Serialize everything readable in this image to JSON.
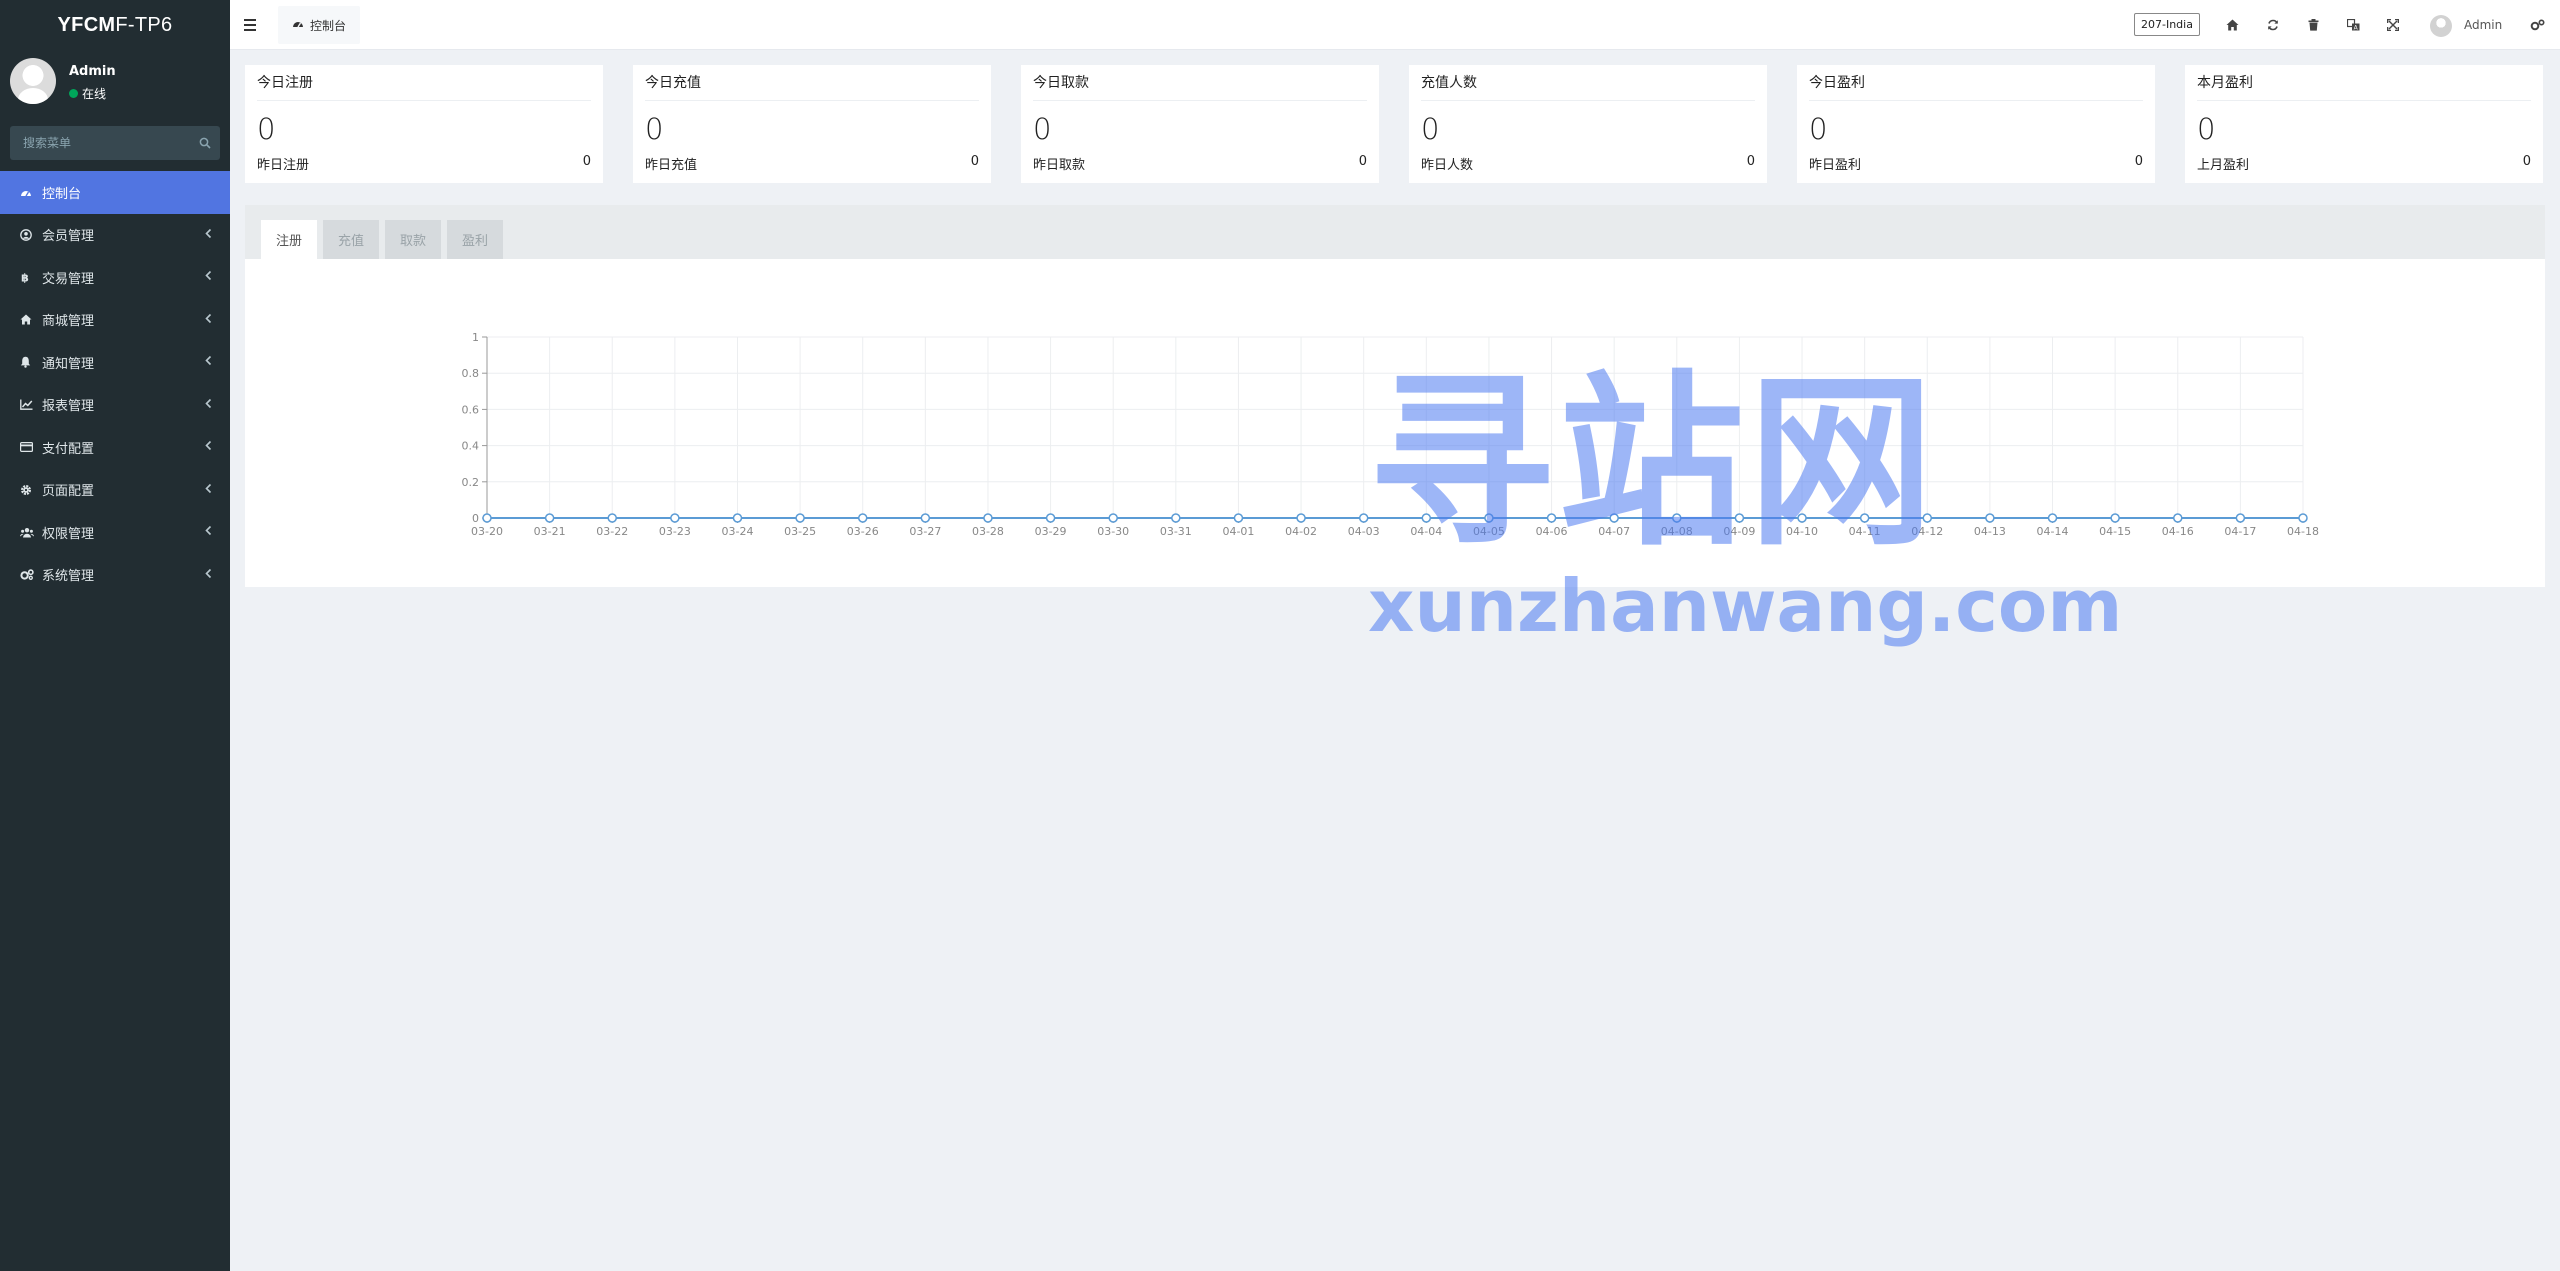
{
  "app": {
    "brand_bold": "YFCM",
    "brand_rest": "F-TP6"
  },
  "user": {
    "name": "Admin",
    "status": "在线"
  },
  "search": {
    "placeholder": "搜索菜单"
  },
  "menu": [
    {
      "label": "控制台",
      "icon": "dashboard-icon"
    },
    {
      "label": "会员管理",
      "icon": "user-circle-icon"
    },
    {
      "label": "交易管理",
      "icon": "bitcoin-icon"
    },
    {
      "label": "商城管理",
      "icon": "home-icon"
    },
    {
      "label": "通知管理",
      "icon": "bell-icon"
    },
    {
      "label": "报表管理",
      "icon": "line-chart-icon"
    },
    {
      "label": "支付配置",
      "icon": "credit-card-icon"
    },
    {
      "label": "页面配置",
      "icon": "gear-icon"
    },
    {
      "label": "权限管理",
      "icon": "users-icon"
    },
    {
      "label": "系统管理",
      "icon": "gears-icon"
    }
  ],
  "topbar": {
    "home_tab": "控制台",
    "lang_button": "207-India",
    "admin_name": "Admin",
    "icons": [
      "home-icon",
      "refresh-icon",
      "trash-icon",
      "translate-icon",
      "fullscreen-icon",
      "settings-icon"
    ]
  },
  "stats": [
    {
      "title": "今日注册",
      "value": "0",
      "sub_label": "昨日注册",
      "sub_value": "0"
    },
    {
      "title": "今日充值",
      "value": "0",
      "sub_label": "昨日充值",
      "sub_value": "0"
    },
    {
      "title": "今日取款",
      "value": "0",
      "sub_label": "昨日取款",
      "sub_value": "0"
    },
    {
      "title": "充值人数",
      "value": "0",
      "sub_label": "昨日人数",
      "sub_value": "0"
    },
    {
      "title": "今日盈利",
      "value": "0",
      "sub_label": "昨日盈利",
      "sub_value": "0"
    },
    {
      "title": "本月盈利",
      "value": "0",
      "sub_label": "上月盈利",
      "sub_value": "0"
    }
  ],
  "tabs": [
    "注册",
    "充值",
    "取款",
    "盈利"
  ],
  "watermark": {
    "main": "寻站网",
    "sub": "xunzhanwang.com"
  },
  "colors": {
    "sidebar_bg": "#222d32",
    "active_menu": "#5175e1",
    "line": "#5b9bd5",
    "online": "#00a65a"
  },
  "chart_data": {
    "type": "line",
    "x": [
      "03-20",
      "03-21",
      "03-22",
      "03-23",
      "03-24",
      "03-25",
      "03-26",
      "03-27",
      "03-28",
      "03-29",
      "03-30",
      "03-31",
      "04-01",
      "04-02",
      "04-03",
      "04-04",
      "04-05",
      "04-06",
      "04-07",
      "04-08",
      "04-09",
      "04-10",
      "04-11",
      "04-12",
      "04-13",
      "04-14",
      "04-15",
      "04-16",
      "04-17",
      "04-18"
    ],
    "series": [
      {
        "values": [
          0,
          0,
          0,
          0,
          0,
          0,
          0,
          0,
          0,
          0,
          0,
          0,
          0,
          0,
          0,
          0,
          0,
          0,
          0,
          0,
          0,
          0,
          0,
          0,
          0,
          0,
          0,
          0,
          0,
          0
        ]
      }
    ],
    "yticks": [
      "0",
      "0.2",
      "0.4",
      "0.6",
      "0.8",
      "1"
    ],
    "ylim": [
      0,
      1
    ],
    "grid": true
  }
}
